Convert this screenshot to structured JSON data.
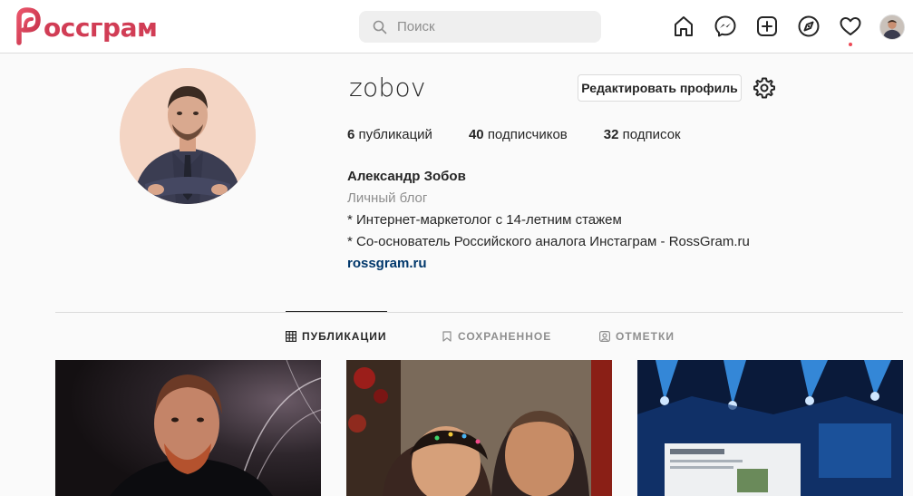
{
  "header": {
    "logo_text": "оссграм",
    "search_placeholder": "Поиск",
    "nav_icons": [
      "home-icon",
      "messenger-icon",
      "new-post-icon",
      "explore-icon",
      "activity-heart-icon",
      "profile-avatar"
    ]
  },
  "profile": {
    "username": "zobov",
    "edit_button": "Редактировать профиль",
    "stats": [
      {
        "count": "6",
        "label": "публикаций"
      },
      {
        "count": "40",
        "label": "подписчиков"
      },
      {
        "count": "32",
        "label": "подписок"
      }
    ],
    "full_name": "Александр Зобов",
    "category": "Личный блог",
    "bio_lines": [
      "* Интернет-маркетолог с 14-летним стажем",
      "* Со-основатель Российского аналога Инстаграм - RossGram.ru"
    ],
    "website": "rossgram.ru"
  },
  "tabs": [
    {
      "label": "ПУБЛИКАЦИИ",
      "icon": "grid-icon",
      "active": true
    },
    {
      "label": "СОХРАНЕННОЕ",
      "icon": "bookmark-icon",
      "active": false
    },
    {
      "label": "ОТМЕТКИ",
      "icon": "tagged-icon",
      "active": false
    }
  ],
  "colors": {
    "brand": "#d13d55",
    "link": "#00376b",
    "notification_dot": "#ed4956"
  }
}
